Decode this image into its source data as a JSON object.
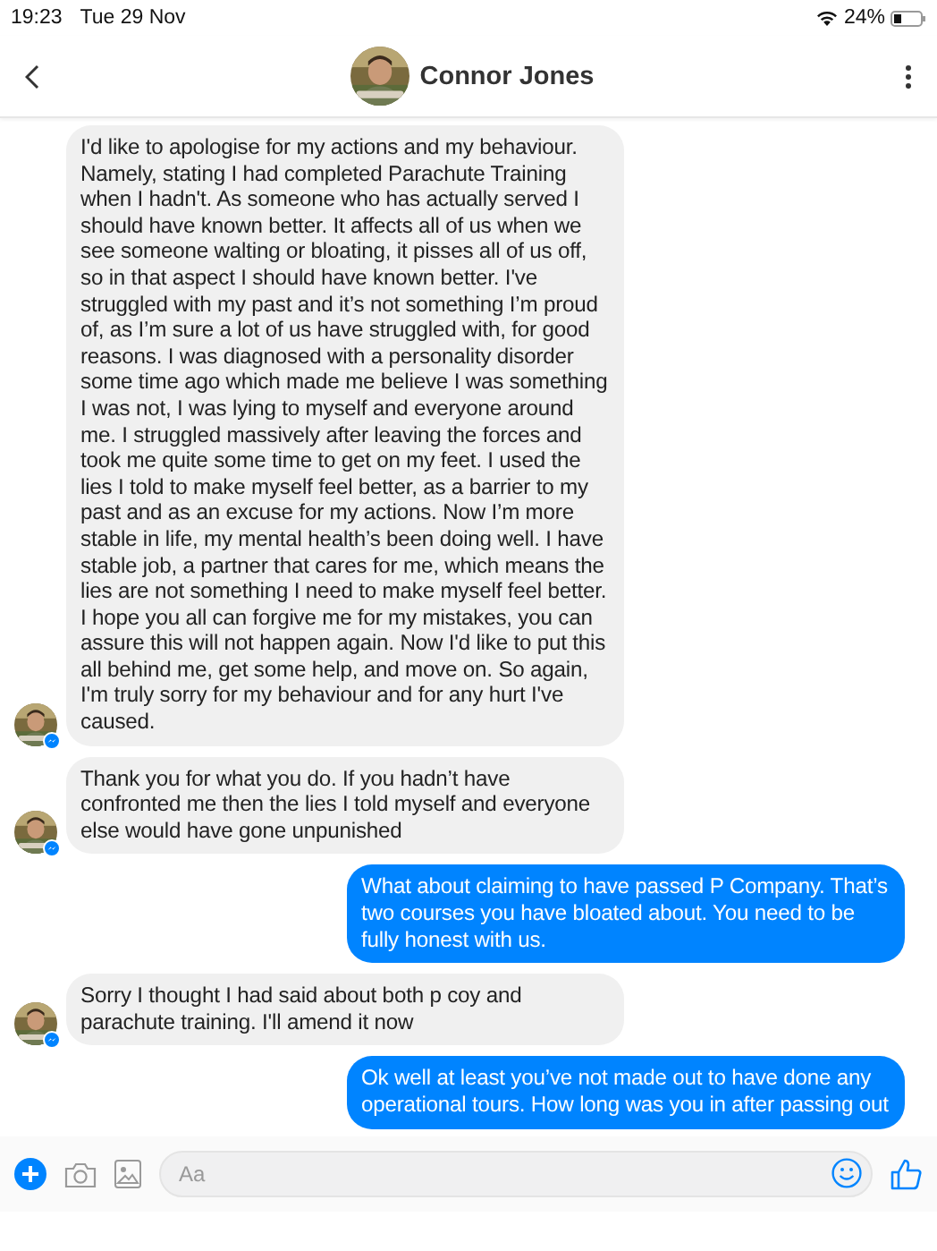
{
  "status_bar": {
    "time": "19:23",
    "date": "Tue 29 Nov",
    "battery": "24%"
  },
  "header": {
    "name": "Connor Jones"
  },
  "messages": [
    {
      "kind": "incoming",
      "text": "I'd like to apologise for my actions and my behaviour. Namely, stating I had completed Parachute Training when I hadn't. As someone who has actually served I should have known better. It affects all of us when we see someone walting or bloating, it pisses all of us off, so in that aspect I should have known better. I've struggled with my past and it’s not something I’m proud of, as I’m sure a lot of us have struggled with, for good reasons. I was diagnosed with a personality disorder some time ago which made me believe I was something I was not, I was lying to myself and everyone around me. I struggled massively after leaving the forces and took me quite some time to get on my feet. I used the lies I told to make myself feel better, as a barrier to my past and as an excuse for my actions. Now I’m more stable in life, my mental health’s been doing well. I have stable job, a partner that cares for me, which means the lies are not something I need to make myself feel better. I hope you all can forgive me for my mistakes, you can assure this will not happen again. Now I'd like to put this all behind me, get some help, and move on. So again, I'm truly sorry for my behaviour and for any hurt I've caused."
    },
    {
      "kind": "incoming",
      "text": "Thank you for what you do. If you hadn’t have confronted me then the lies I told myself and everyone else would have gone unpunished"
    },
    {
      "kind": "outgoing",
      "text": "What about claiming to have passed P Company. That’s two courses you have bloated about. You need to be fully honest with us."
    },
    {
      "kind": "incoming",
      "text": "Sorry I thought I had said about both p coy and parachute training. I'll amend it now"
    },
    {
      "kind": "outgoing",
      "text": "Ok well at least you’ve not made out to have done any operational tours. How long was you in after passing out"
    }
  ],
  "composer": {
    "placeholder": "Aa"
  }
}
